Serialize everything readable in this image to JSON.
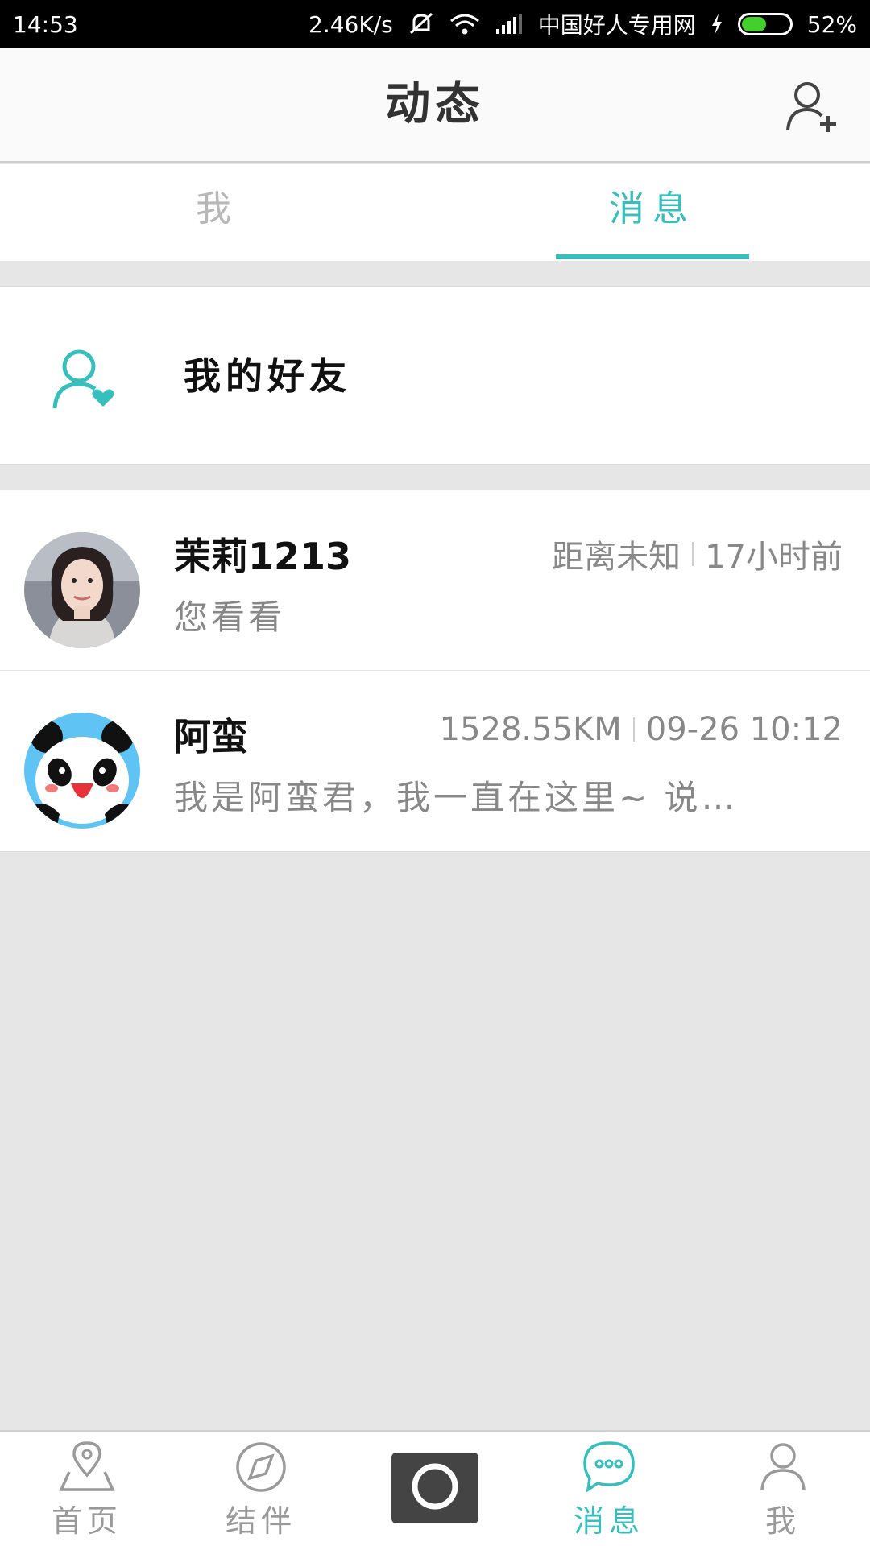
{
  "status_bar": {
    "time": "14:53",
    "net_speed": "2.46K/s",
    "carrier": "中国好人专用网",
    "battery": "52%",
    "battery_level": 0.52
  },
  "header": {
    "title": "动态"
  },
  "tabs": [
    {
      "label": "我",
      "active": false
    },
    {
      "label": "消息",
      "active": true
    }
  ],
  "friends": {
    "label": "我的好友"
  },
  "messages": [
    {
      "name": "茉莉1213",
      "distance": "距离未知",
      "time": "17小时前",
      "preview": "您看看",
      "avatar": "woman-portrait"
    },
    {
      "name": "阿蛮",
      "distance": "1528.55KM",
      "time": "09-26 10:12",
      "preview": "我是阿蛮君，我一直在这里~ 说…",
      "avatar": "panda-icon"
    }
  ],
  "bottom_nav": [
    {
      "label": "首页",
      "icon": "location-pin-icon",
      "active": false
    },
    {
      "label": "结伴",
      "icon": "compass-icon",
      "active": false
    },
    {
      "label": "",
      "icon": "camera-icon",
      "active": false
    },
    {
      "label": "消息",
      "icon": "chat-bubble-icon",
      "active": true
    },
    {
      "label": "我",
      "icon": "person-icon",
      "active": false
    }
  ],
  "colors": {
    "accent": "#36bfbc",
    "background": "#e6e6e6",
    "text_muted": "#888888"
  }
}
